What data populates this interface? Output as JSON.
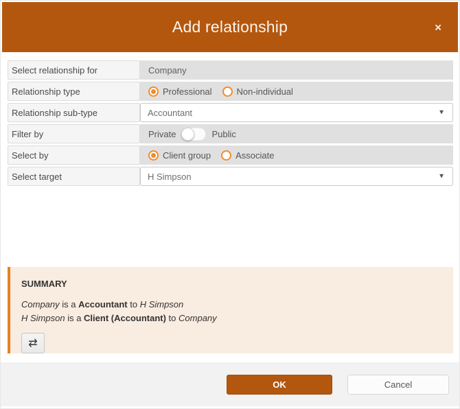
{
  "modal": {
    "title": "Add relationship"
  },
  "icons": {
    "close": "×",
    "dropdown_arrow": "▼",
    "swap": "⇄"
  },
  "form": {
    "rows": [
      {
        "label": "Select relationship for",
        "type": "static",
        "value": "Company"
      },
      {
        "label": "Relationship type",
        "type": "radio",
        "options": [
          {
            "label": "Professional",
            "selected": true
          },
          {
            "label": "Non-individual",
            "selected": false
          }
        ]
      },
      {
        "label": "Relationship sub-type",
        "type": "select",
        "value": "Accountant"
      },
      {
        "label": "Filter by",
        "type": "toggle",
        "off_label": "Private",
        "on_label": "Public",
        "state": "Private"
      },
      {
        "label": "Select by",
        "type": "radio",
        "options": [
          {
            "label": "Client group",
            "selected": true
          },
          {
            "label": "Associate",
            "selected": false
          }
        ]
      },
      {
        "label": "Select target",
        "type": "select",
        "value": "H Simpson"
      }
    ]
  },
  "summary": {
    "heading": "SUMMARY",
    "lines": [
      {
        "subject": "Company",
        "mid": " is a ",
        "relation": "Accountant",
        "to": " to ",
        "object": "H Simpson"
      },
      {
        "subject": "H Simpson",
        "mid": " is a ",
        "relation": "Client (Accountant)",
        "to": " to ",
        "object": "Company"
      }
    ]
  },
  "footer": {
    "ok_label": "OK",
    "cancel_label": "Cancel"
  },
  "colors": {
    "header_bg": "#b4570e",
    "accent_orange": "#f28c28",
    "summary_bg": "#f9ece0",
    "summary_border": "#e6831f",
    "row_value_bg": "#e0e0e0",
    "footer_bg": "#f2f2f2"
  }
}
